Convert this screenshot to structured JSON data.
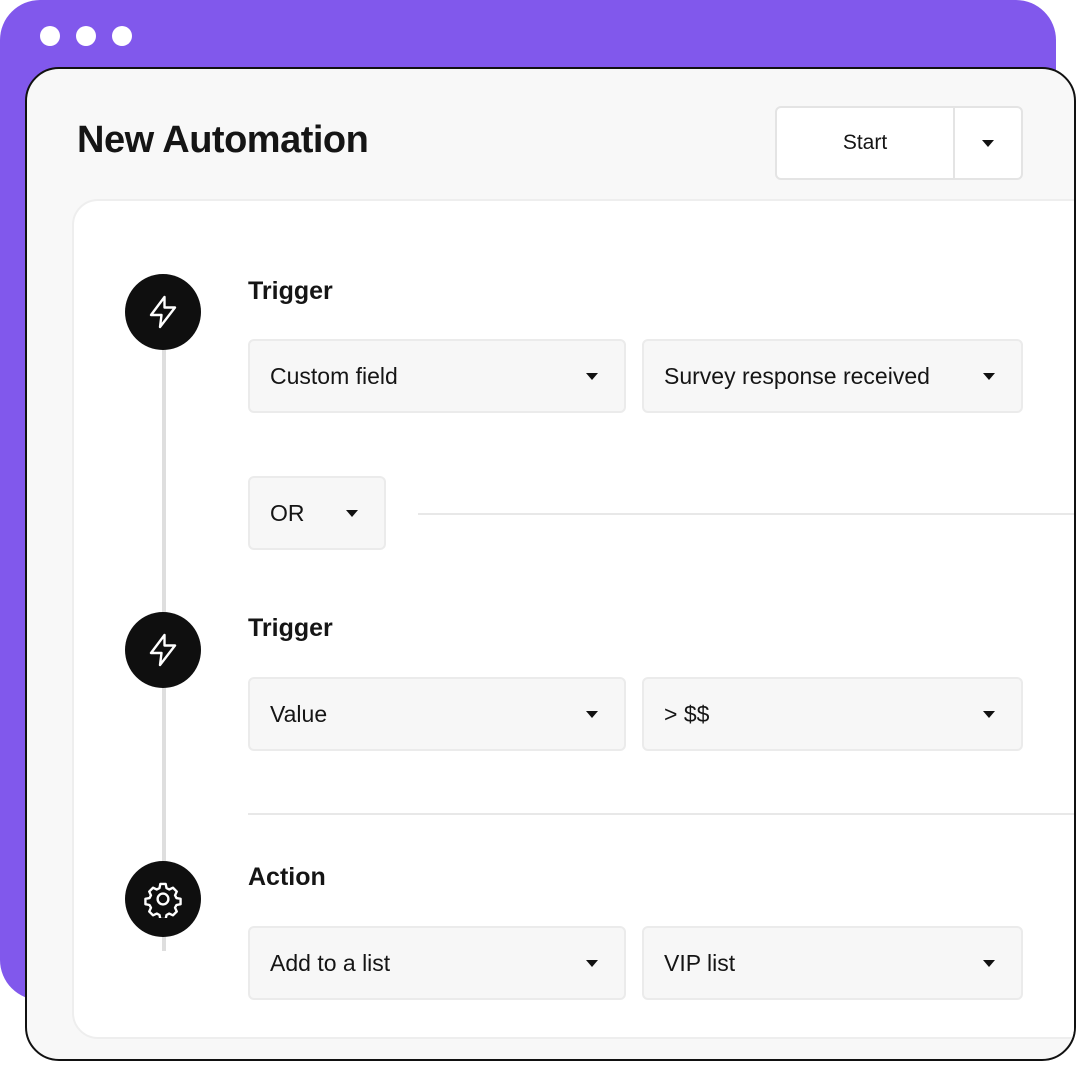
{
  "window": {
    "title": "New Automation",
    "start_button": {
      "label": "Start"
    }
  },
  "colors": {
    "accent": "#8158ec",
    "icon_bg": "#0f0f0f",
    "select_bg": "#f7f7f7"
  },
  "steps": [
    {
      "type": "trigger",
      "icon": "lightning-icon",
      "label": "Trigger",
      "selects": [
        {
          "value": "Custom field"
        },
        {
          "value": "Survey response received"
        }
      ]
    },
    {
      "type": "operator",
      "value": "OR"
    },
    {
      "type": "trigger",
      "icon": "lightning-icon",
      "label": "Trigger",
      "selects": [
        {
          "value": "Value"
        },
        {
          "value": "> $$"
        }
      ]
    },
    {
      "type": "action",
      "icon": "gear-icon",
      "label": "Action",
      "selects": [
        {
          "value": "Add to a list"
        },
        {
          "value": "VIP list"
        }
      ]
    }
  ]
}
